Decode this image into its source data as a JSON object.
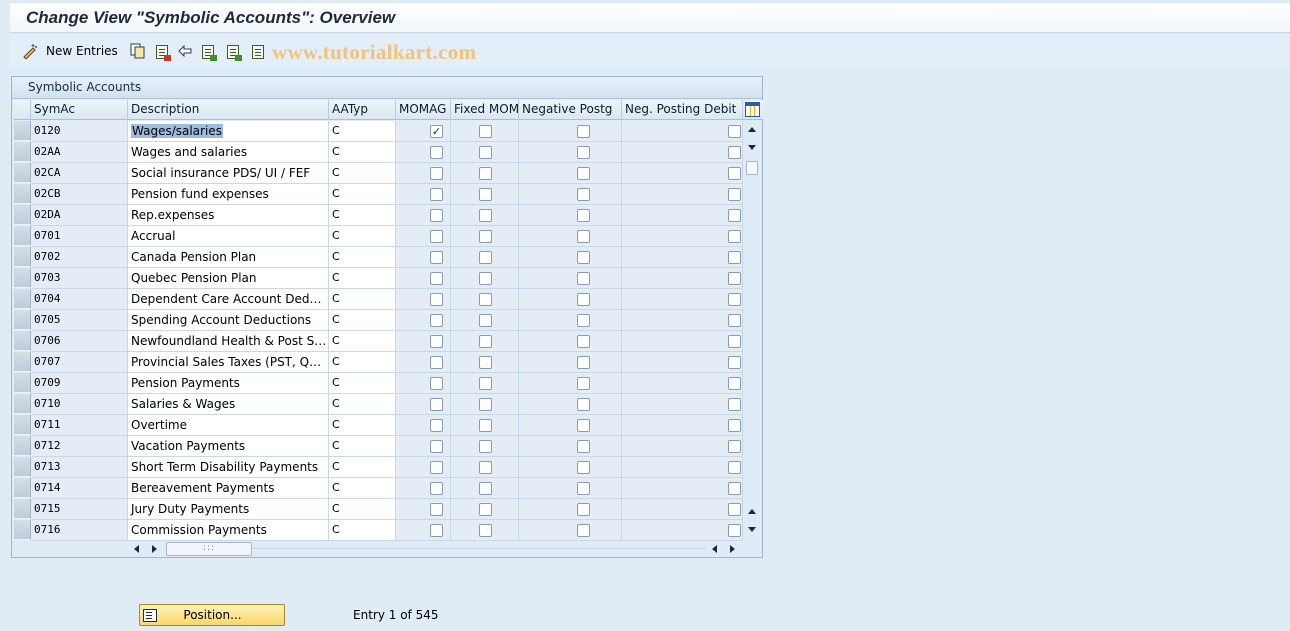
{
  "window": {
    "title": "Change View \"Symbolic Accounts\": Overview"
  },
  "toolbar": {
    "new_entries_label": "New Entries",
    "icons": [
      "new-entries-icon",
      "copy-icon",
      "delete-icon",
      "undo-change-icon",
      "select-all-icon",
      "select-block-icon",
      "deselect-all-icon"
    ]
  },
  "watermark": "www.tutorialkart.com",
  "table": {
    "caption": "Symbolic Accounts",
    "columns": {
      "symac": "SymAc",
      "description": "Description",
      "aatyp": "AATyp",
      "momag": "MOMAG",
      "fixed_mom": "Fixed MOM",
      "negative_postg": "Negative Postg",
      "neg_posting_debit": "Neg. Posting Debit"
    },
    "rows": [
      {
        "symac": "0120",
        "description": "Wages/salaries",
        "aatyp": "C",
        "momag": true,
        "fixed_mom": false,
        "negative_postg": false,
        "neg_posting_debit": false,
        "selected": true
      },
      {
        "symac": "02AA",
        "description": "Wages and salaries",
        "aatyp": "C",
        "momag": false,
        "fixed_mom": false,
        "negative_postg": false,
        "neg_posting_debit": false
      },
      {
        "symac": "02CA",
        "description": "Social insurance PDS/ UI / FEF",
        "aatyp": "C",
        "momag": false,
        "fixed_mom": false,
        "negative_postg": false,
        "neg_posting_debit": false
      },
      {
        "symac": "02CB",
        "description": "Pension fund expenses",
        "aatyp": "C",
        "momag": false,
        "fixed_mom": false,
        "negative_postg": false,
        "neg_posting_debit": false
      },
      {
        "symac": "02DA",
        "description": "Rep.expenses",
        "aatyp": "C",
        "momag": false,
        "fixed_mom": false,
        "negative_postg": false,
        "neg_posting_debit": false
      },
      {
        "symac": "0701",
        "description": "Accrual",
        "aatyp": "C",
        "momag": false,
        "fixed_mom": false,
        "negative_postg": false,
        "neg_posting_debit": false
      },
      {
        "symac": "0702",
        "description": "Canada Pension Plan",
        "aatyp": "C",
        "momag": false,
        "fixed_mom": false,
        "negative_postg": false,
        "neg_posting_debit": false
      },
      {
        "symac": "0703",
        "description": "Quebec Pension Plan",
        "aatyp": "C",
        "momag": false,
        "fixed_mom": false,
        "negative_postg": false,
        "neg_posting_debit": false
      },
      {
        "symac": "0704",
        "description": "Dependent Care Account Deductio…",
        "aatyp": "C",
        "momag": false,
        "fixed_mom": false,
        "negative_postg": false,
        "neg_posting_debit": false
      },
      {
        "symac": "0705",
        "description": "Spending Account Deductions",
        "aatyp": "C",
        "momag": false,
        "fixed_mom": false,
        "negative_postg": false,
        "neg_posting_debit": false
      },
      {
        "symac": "0706",
        "description": "Newfoundland Health & Post Sec E…",
        "aatyp": "C",
        "momag": false,
        "fixed_mom": false,
        "negative_postg": false,
        "neg_posting_debit": false
      },
      {
        "symac": "0707",
        "description": "Provincial Sales Taxes (PST, QST)",
        "aatyp": "C",
        "momag": false,
        "fixed_mom": false,
        "negative_postg": false,
        "neg_posting_debit": false
      },
      {
        "symac": "0709",
        "description": "Pension Payments",
        "aatyp": "C",
        "momag": false,
        "fixed_mom": false,
        "negative_postg": false,
        "neg_posting_debit": false
      },
      {
        "symac": "0710",
        "description": "Salaries & Wages",
        "aatyp": "C",
        "momag": false,
        "fixed_mom": false,
        "negative_postg": false,
        "neg_posting_debit": false
      },
      {
        "symac": "0711",
        "description": "Overtime",
        "aatyp": "C",
        "momag": false,
        "fixed_mom": false,
        "negative_postg": false,
        "neg_posting_debit": false
      },
      {
        "symac": "0712",
        "description": "Vacation Payments",
        "aatyp": "C",
        "momag": false,
        "fixed_mom": false,
        "negative_postg": false,
        "neg_posting_debit": false
      },
      {
        "symac": "0713",
        "description": "Short Term Disability Payments",
        "aatyp": "C",
        "momag": false,
        "fixed_mom": false,
        "negative_postg": false,
        "neg_posting_debit": false
      },
      {
        "symac": "0714",
        "description": "Bereavement Payments",
        "aatyp": "C",
        "momag": false,
        "fixed_mom": false,
        "negative_postg": false,
        "neg_posting_debit": false
      },
      {
        "symac": "0715",
        "description": "Jury Duty Payments",
        "aatyp": "C",
        "momag": false,
        "fixed_mom": false,
        "negative_postg": false,
        "neg_posting_debit": false
      },
      {
        "symac": "0716",
        "description": "Commission Payments",
        "aatyp": "C",
        "momag": false,
        "fixed_mom": false,
        "negative_postg": false,
        "neg_posting_debit": false
      }
    ],
    "hscroll_thumb_glyph": ":::"
  },
  "footer": {
    "position_button_label": "Position...",
    "entry_info": "Entry 1 of 545"
  },
  "colors": {
    "background": "#dfebf5",
    "highlight": "#9cbce0",
    "position_button": "#f8d66a"
  }
}
